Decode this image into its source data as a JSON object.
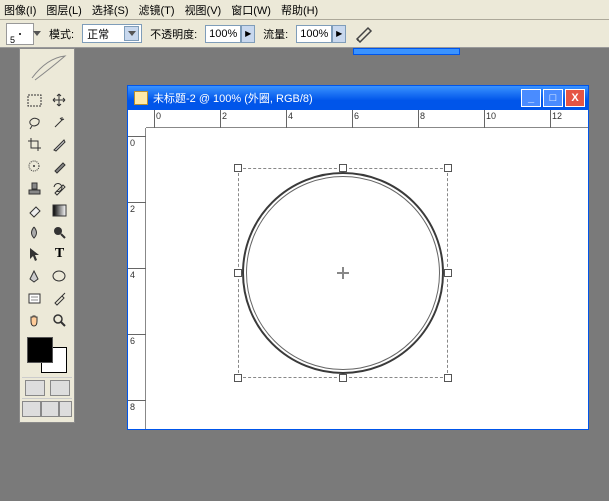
{
  "menu": {
    "image": "图像(I)",
    "layer": "图层(L)",
    "select": "选择(S)",
    "filter": "滤镜(T)",
    "view": "视图(V)",
    "window": "窗口(W)",
    "help": "帮助(H)"
  },
  "options": {
    "brush_size": "5",
    "mode_label": "模式:",
    "mode_value": "正常",
    "opacity_label": "不透明度:",
    "opacity_value": "100%",
    "flow_label": "流量:",
    "flow_value": "100%"
  },
  "doc": {
    "title": "未标题-2 @ 100% (外圈, RGB/8)",
    "hruler": [
      "0",
      "2",
      "4",
      "6",
      "8",
      "10",
      "12"
    ],
    "vruler": [
      "0",
      "2",
      "4",
      "6",
      "8"
    ]
  },
  "icons": {
    "feather": "feather",
    "marquee": "▭",
    "move": "✥",
    "lasso": "ʆ",
    "wand": "✶",
    "crop": "▨",
    "slice": "/",
    "heal": "◍",
    "brush": "/",
    "stamp": "⌘",
    "history": "↺",
    "eraser": "▱",
    "grad": "▦",
    "blur": "●",
    "dodge": "◐",
    "path": "↖",
    "type": "T",
    "pen": "N",
    "shape": "○",
    "notes": "▭",
    "eyedrop": "/",
    "hand": "✋",
    "zoom": "🔍"
  }
}
